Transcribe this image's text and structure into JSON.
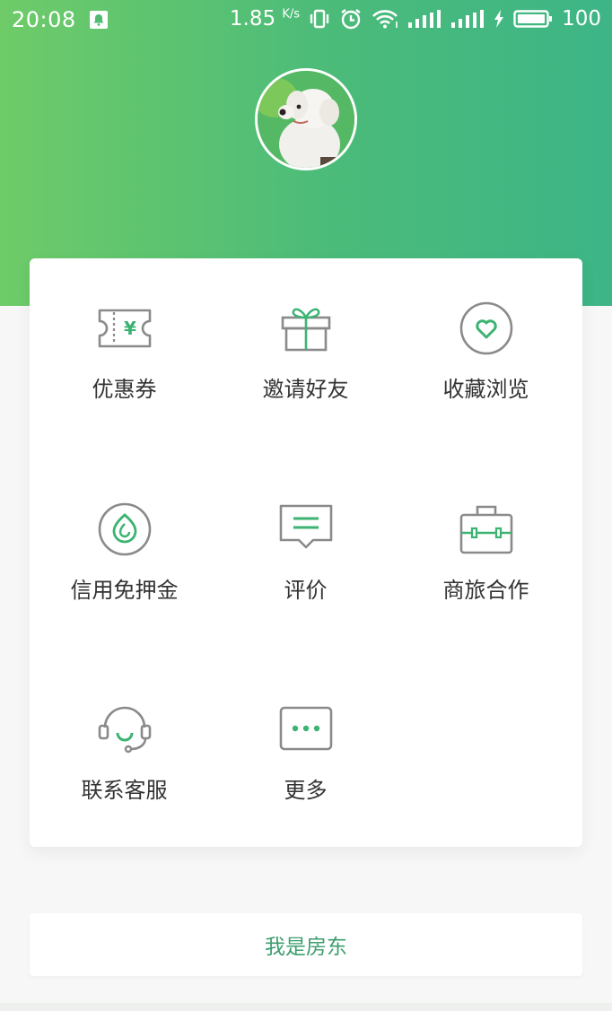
{
  "status_bar": {
    "time": "20:08",
    "speed": "1.85",
    "speed_unit": "K/s",
    "battery": "100",
    "icons": [
      "notification-icon",
      "vibrate-icon",
      "alarm-icon",
      "wifi-icon",
      "signal-icon",
      "signal-icon",
      "charging-icon",
      "battery-icon"
    ]
  },
  "colors": {
    "header_gradient_start": "#6ecb68",
    "header_gradient_end": "#3db586",
    "accent": "#3cb371",
    "icon_gray": "#8a8a8a"
  },
  "profile": {
    "avatar": "dog-avatar"
  },
  "menu": {
    "items": [
      {
        "label": "优惠券",
        "icon": "coupon-icon"
      },
      {
        "label": "邀请好友",
        "icon": "gift-icon"
      },
      {
        "label": "收藏浏览",
        "icon": "heart-icon"
      },
      {
        "label": "信用免押金",
        "icon": "credit-leaf-icon"
      },
      {
        "label": "评价",
        "icon": "comment-icon"
      },
      {
        "label": "商旅合作",
        "icon": "briefcase-icon"
      },
      {
        "label": "联系客服",
        "icon": "headset-icon"
      },
      {
        "label": "更多",
        "icon": "more-icon"
      }
    ]
  },
  "landlord": {
    "label": "我是房东"
  }
}
